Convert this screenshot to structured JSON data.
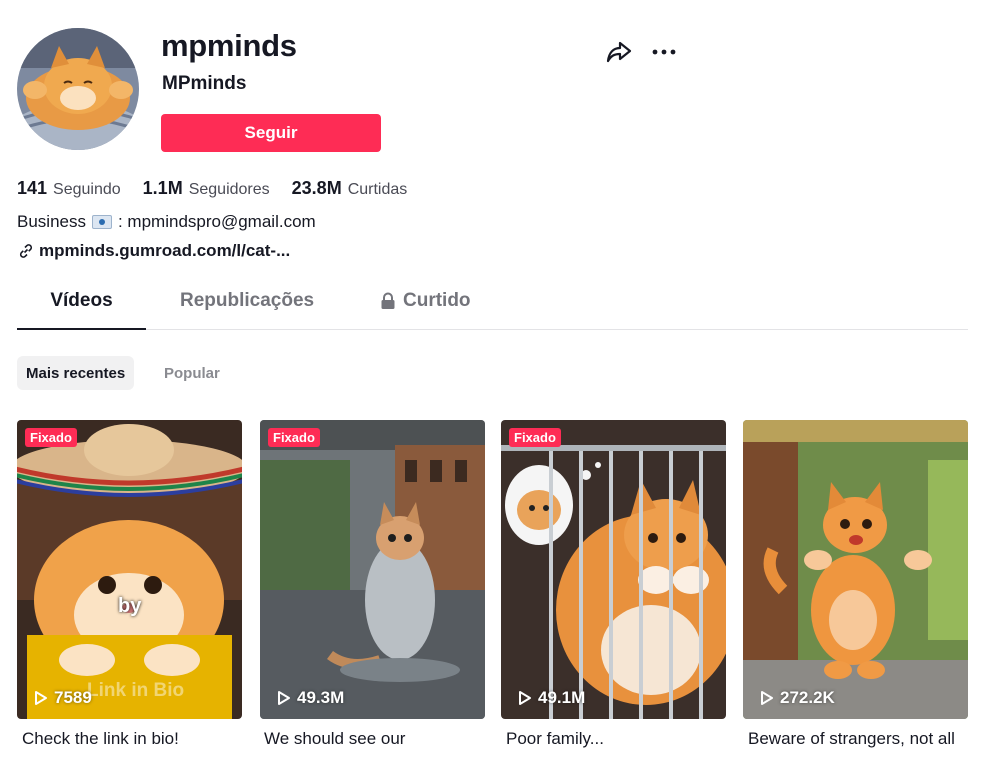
{
  "profile": {
    "username": "mpminds",
    "nickname": "MPminds",
    "follow_label": "Seguir",
    "share_icon": "share-icon",
    "more_icon": "more-icon"
  },
  "stats": [
    {
      "value": "141",
      "label": "Seguindo"
    },
    {
      "value": "1.1M",
      "label": "Seguidores"
    },
    {
      "value": "23.8M",
      "label": "Curtidas"
    }
  ],
  "bio": {
    "prefix": "Business",
    "email_text": ": mpmindspro@gmail.com",
    "link": "mpminds.gumroad.com/l/cat-..."
  },
  "tabs": {
    "videos": "Vídeos",
    "reposts": "Republicações",
    "liked": "Curtido"
  },
  "sort": {
    "recent": "Mais recentes",
    "popular": "Popular"
  },
  "colors": {
    "accent": "#fe2c55",
    "text": "#161823",
    "muted": "#73747b"
  },
  "videos": [
    {
      "pinned_label": "Fixado",
      "views": "7589",
      "caption": "Check the link in bio!",
      "overlay_word": "by",
      "overlay_faint": "Link in Bio"
    },
    {
      "pinned_label": "Fixado",
      "views": "49.3M",
      "caption": "We should see our"
    },
    {
      "pinned_label": "Fixado",
      "views": "49.1M",
      "caption": "Poor family..."
    },
    {
      "views": "272.2K",
      "caption": "Beware of strangers, not all"
    }
  ]
}
